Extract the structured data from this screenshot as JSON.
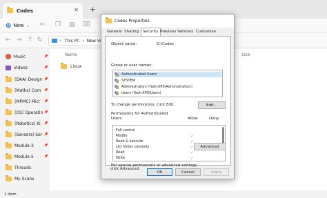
{
  "explorer": {
    "tab_title": "Codes",
    "new_label": "New",
    "address_segments": [
      "This PC",
      "New Volu"
    ],
    "column_name": "Name",
    "column_size": "Size",
    "folder_item": "Linux",
    "status": "1 item",
    "sidebar": [
      {
        "label": "Music",
        "icon": "music",
        "pinned": true
      },
      {
        "label": "Videos",
        "icon": "video",
        "pinned": true
      },
      {
        "label": "(DAA) Design",
        "icon": "folder",
        "pinned": true
      },
      {
        "label": "(Maths) Com",
        "icon": "folder",
        "pinned": true
      },
      {
        "label": "(MPMC) Micr",
        "icon": "folder",
        "pinned": true
      },
      {
        "label": "(OS) Operatin",
        "icon": "folder",
        "pinned": true
      },
      {
        "label": "(Robotics) Ki",
        "icon": "folder",
        "pinned": true
      },
      {
        "label": "(Sensors) Ser",
        "icon": "folder",
        "pinned": true
      },
      {
        "label": "Module-3",
        "icon": "folder",
        "pinned": true
      },
      {
        "label": "Module-5",
        "icon": "folder",
        "pinned": true
      },
      {
        "label": "Threads",
        "icon": "folder",
        "pinned": false
      },
      {
        "label": "My Scans",
        "icon": "folder",
        "pinned": false
      }
    ]
  },
  "dialog": {
    "title": "Codes Properties",
    "tabs": [
      "General",
      "Sharing",
      "Security",
      "Previous Versions",
      "Customise"
    ],
    "active_tab": "Security",
    "object_name_label": "Object name:",
    "object_name_value": "D:\\Codes",
    "groups_label": "Group or user names:",
    "users": [
      "Authenticated Users",
      "SYSTEM",
      "Administrators (Yash-XPS\\Administrators)",
      "Users (Yash-XPS\\Users)"
    ],
    "change_text": "To change permissions, click Edit.",
    "edit_button": "Edit...",
    "permissions_label": "Permissions for Authenticated",
    "permissions_label2": "Users",
    "allow_header": "Allow",
    "deny_header": "Deny",
    "permissions": [
      {
        "name": "Full control",
        "allow": false
      },
      {
        "name": "Modify",
        "allow": true
      },
      {
        "name": "Read & execute",
        "allow": true
      },
      {
        "name": "List folder contents",
        "allow": true
      },
      {
        "name": "Read",
        "allow": true
      },
      {
        "name": "Write",
        "allow": true
      }
    ],
    "special_text": "For special permissions or advanced settings,",
    "special_text2": "click Advanced.",
    "advanced_button": "Advanced",
    "ok_button": "OK",
    "cancel_button": "Cancel",
    "apply_button": "Apply",
    "check_glyph": "✓"
  }
}
